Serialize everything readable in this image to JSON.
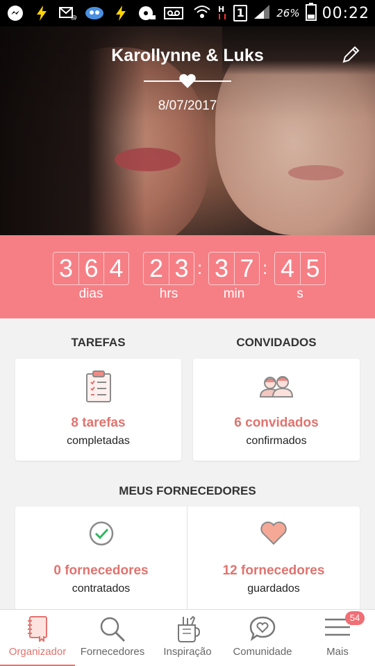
{
  "status_bar": {
    "battery_percent": "26%",
    "time": "00:22",
    "sim_slot": "1"
  },
  "hero": {
    "names": "Karollynne & Luks",
    "date": "8/07/2017"
  },
  "countdown": {
    "days": [
      "3",
      "6",
      "4"
    ],
    "hours": [
      "2",
      "3"
    ],
    "minutes": [
      "3",
      "7"
    ],
    "seconds": [
      "4",
      "5"
    ],
    "separator": ":",
    "labels": {
      "days": "dias",
      "hours": "hrs",
      "minutes": "min",
      "seconds": "s"
    }
  },
  "tasks": {
    "title": "TAREFAS",
    "count": "8 tarefas",
    "caption": "completadas"
  },
  "guests": {
    "title": "CONVIDADOS",
    "count": "6 convidados",
    "caption": "confirmados"
  },
  "vendors": {
    "title": "MEUS FORNECEDORES",
    "hired_count": "0 fornecedores",
    "hired_caption": "contratados",
    "saved_count": "12 fornecedores",
    "saved_caption": "guardados"
  },
  "nav": {
    "items": [
      {
        "label": "Organizador",
        "icon": "notebook-icon"
      },
      {
        "label": "Fornecedores",
        "icon": "search-icon"
      },
      {
        "label": "Inspiração",
        "icon": "cup-icon"
      },
      {
        "label": "Comunidade",
        "icon": "chat-heart-icon"
      },
      {
        "label": "Mais",
        "icon": "menu-icon"
      }
    ],
    "badge": "54"
  },
  "colors": {
    "accent": "#f57f85",
    "highlight_text": "#e0736e"
  }
}
